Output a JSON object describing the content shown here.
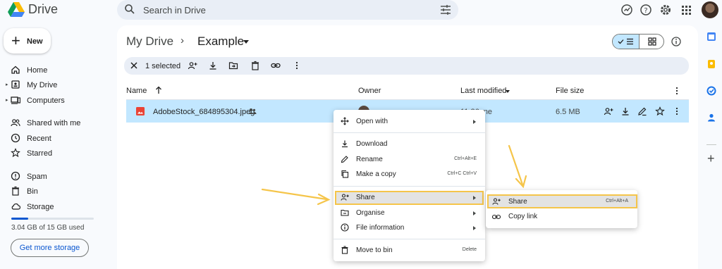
{
  "app": {
    "title": "Drive"
  },
  "search": {
    "placeholder": "Search in Drive"
  },
  "sidebar": {
    "new_label": "New",
    "items": [
      {
        "label": "Home"
      },
      {
        "label": "My Drive"
      },
      {
        "label": "Computers"
      },
      {
        "label": "Shared with me"
      },
      {
        "label": "Recent"
      },
      {
        "label": "Starred"
      },
      {
        "label": "Spam"
      },
      {
        "label": "Bin"
      },
      {
        "label": "Storage"
      }
    ],
    "storage": {
      "used_text": "3.04 GB of 15 GB used",
      "used_fraction": 0.2027,
      "button": "Get more storage"
    }
  },
  "breadcrumb": {
    "root": "My Drive",
    "separator": "›",
    "current": "Example"
  },
  "selection": {
    "count_text": "1 selected"
  },
  "columns": {
    "name": "Name",
    "owner": "Owner",
    "last_modified": "Last modified",
    "file_size": "File size"
  },
  "file": {
    "name": "AdobeStock_684895304.jpeg",
    "owner": "me",
    "modified": "11:26 me",
    "size": "6.5 MB"
  },
  "context_menu": {
    "items": [
      {
        "label": "Open with",
        "shortcut": ""
      },
      {
        "label": "Download",
        "shortcut": ""
      },
      {
        "label": "Rename",
        "shortcut": "Ctrl+Alt+E"
      },
      {
        "label": "Make a copy",
        "shortcut": "Ctrl+C Ctrl+V"
      },
      {
        "label": "Share",
        "shortcut": ""
      },
      {
        "label": "Organise",
        "shortcut": ""
      },
      {
        "label": "File information",
        "shortcut": ""
      },
      {
        "label": "Move to bin",
        "shortcut": "Delete"
      }
    ]
  },
  "share_submenu": {
    "items": [
      {
        "label": "Share",
        "shortcut": "Ctrl+Alt+A"
      },
      {
        "label": "Copy link",
        "shortcut": ""
      }
    ]
  },
  "colors": {
    "accent": "#0b57d0",
    "selection": "#c2e7ff",
    "highlight_border": "#f5c54a",
    "annotation_arrow": "#f5c54a"
  }
}
